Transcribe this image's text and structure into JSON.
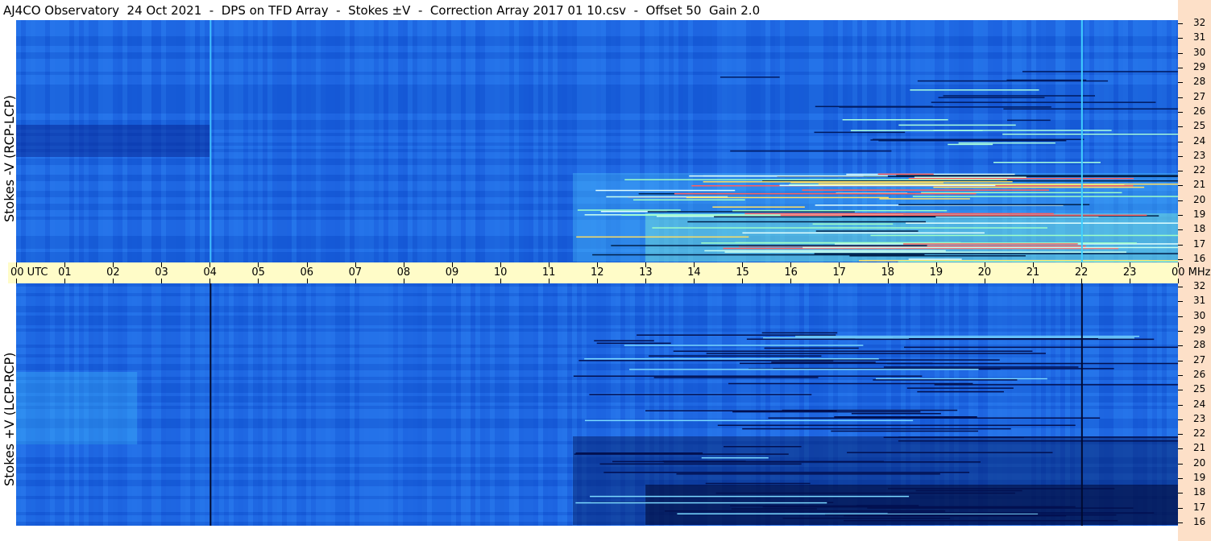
{
  "title": "AJ4CO Observatory  24 Oct 2021  -  DPS on TFD Array  -  Stokes ±V  -  Correction Array 2017 01 10.csv  -  Offset 50  Gain 2.0",
  "chart_data": [
    {
      "type": "heatmap",
      "panel": "top",
      "ylabel": "Stokes -V (RCP-LCP)",
      "x_ticks": [
        "00 UTC",
        "01",
        "02",
        "03",
        "04",
        "05",
        "06",
        "07",
        "08",
        "09",
        "10",
        "11",
        "12",
        "13",
        "14",
        "15",
        "16",
        "17",
        "18",
        "19",
        "20",
        "21",
        "22",
        "23",
        "00 MHz"
      ],
      "x_range_utc_hours": [
        0,
        24
      ],
      "y_ticks_mhz": [
        32,
        31,
        30,
        29,
        28,
        27,
        26,
        25,
        24,
        23,
        22,
        21,
        20,
        19,
        18,
        17,
        16
      ],
      "y_range_mhz": [
        16,
        32
      ],
      "dominant_color": "#1e6be6",
      "burst_color": "#9fffc8",
      "activity_start_utc_hours": 11.5
    },
    {
      "type": "heatmap",
      "panel": "bottom",
      "ylabel": "Stokes +V (LCP-RCP)",
      "x_ticks": [
        "00 UTC",
        "01",
        "02",
        "03",
        "04",
        "05",
        "06",
        "07",
        "08",
        "09",
        "10",
        "11",
        "12",
        "13",
        "14",
        "15",
        "16",
        "17",
        "18",
        "19",
        "20",
        "21",
        "22",
        "23",
        "00 MHz"
      ],
      "x_range_utc_hours": [
        0,
        24
      ],
      "y_ticks_mhz": [
        32,
        31,
        30,
        29,
        28,
        27,
        26,
        25,
        24,
        23,
        22,
        21,
        20,
        19,
        18,
        17,
        16
      ],
      "y_range_mhz": [
        16,
        32
      ],
      "dominant_color": "#1e6be6",
      "dark_color": "#021050",
      "activity_start_utc_hours": 11.5
    }
  ]
}
